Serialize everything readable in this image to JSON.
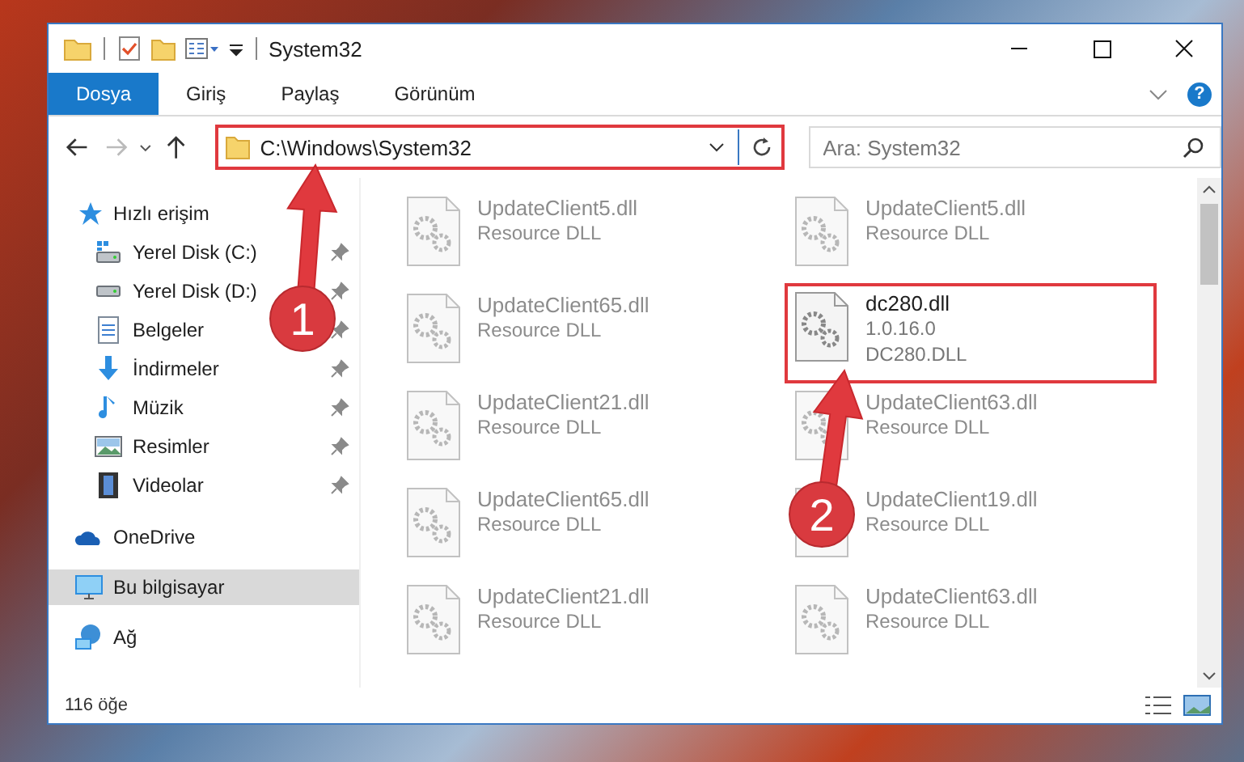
{
  "window": {
    "title": "System32"
  },
  "ribbon": {
    "tabs": [
      {
        "label": "Dosya",
        "selected": true
      },
      {
        "label": "Giriş",
        "selected": false
      },
      {
        "label": "Paylaş",
        "selected": false
      },
      {
        "label": "Görünüm",
        "selected": false
      }
    ],
    "help": "?"
  },
  "address_bar": {
    "path": "C:\\Windows\\System32",
    "highlighted": true
  },
  "search": {
    "placeholder": "Ara: System32"
  },
  "sidebar": {
    "items": [
      {
        "label": "Hızlı erişim",
        "kind": "quick-access",
        "selected": false,
        "children": [
          {
            "label": "Yerel Disk (C:)",
            "kind": "drive-system",
            "pinned": true,
            "selected": false
          },
          {
            "label": "Yerel Disk (D:)",
            "kind": "drive",
            "pinned": true,
            "selected": false
          },
          {
            "label": "Belgeler",
            "kind": "documents",
            "pinned": true,
            "selected": false
          },
          {
            "label": "İndirmeler",
            "kind": "downloads",
            "pinned": true,
            "selected": false
          },
          {
            "label": "Müzik",
            "kind": "music",
            "pinned": true,
            "selected": false
          },
          {
            "label": "Resimler",
            "kind": "pictures",
            "pinned": true,
            "selected": false
          },
          {
            "label": "Videolar",
            "kind": "videos",
            "pinned": true,
            "selected": false
          }
        ]
      },
      {
        "label": "OneDrive",
        "kind": "cloud",
        "selected": false
      },
      {
        "label": "Bu bilgisayar",
        "kind": "computer",
        "selected": true
      },
      {
        "label": "Ağ",
        "kind": "network",
        "selected": false
      }
    ]
  },
  "files": [
    {
      "name": "UpdateClient5.dll",
      "lines": [
        "Resource DLL"
      ],
      "dimmed": true,
      "highlighted": false
    },
    {
      "name": "UpdateClient5.dll",
      "lines": [
        "Resource DLL"
      ],
      "dimmed": true,
      "highlighted": false
    },
    {
      "name": "UpdateClient65.dll",
      "lines": [
        "Resource DLL"
      ],
      "dimmed": true,
      "highlighted": false
    },
    {
      "name": "dc280.dll",
      "lines": [
        "1.0.16.0",
        "DC280.DLL"
      ],
      "dimmed": false,
      "highlighted": true
    },
    {
      "name": "UpdateClient21.dll",
      "lines": [
        "Resource DLL"
      ],
      "dimmed": true,
      "highlighted": false
    },
    {
      "name": "UpdateClient63.dll",
      "lines": [
        "Resource DLL"
      ],
      "dimmed": true,
      "highlighted": false
    },
    {
      "name": "UpdateClient65.dll",
      "lines": [
        "Resource DLL"
      ],
      "dimmed": true,
      "highlighted": false
    },
    {
      "name": "UpdateClient19.dll",
      "lines": [
        "Resource DLL"
      ],
      "dimmed": true,
      "highlighted": false
    },
    {
      "name": "UpdateClient21.dll",
      "lines": [
        "Resource DLL"
      ],
      "dimmed": true,
      "highlighted": false
    },
    {
      "name": "UpdateClient63.dll",
      "lines": [
        "Resource DLL"
      ],
      "dimmed": true,
      "highlighted": false
    }
  ],
  "status_bar": {
    "count": "116 öğe"
  },
  "annotations": [
    {
      "number": "1"
    },
    {
      "number": "2"
    }
  ]
}
